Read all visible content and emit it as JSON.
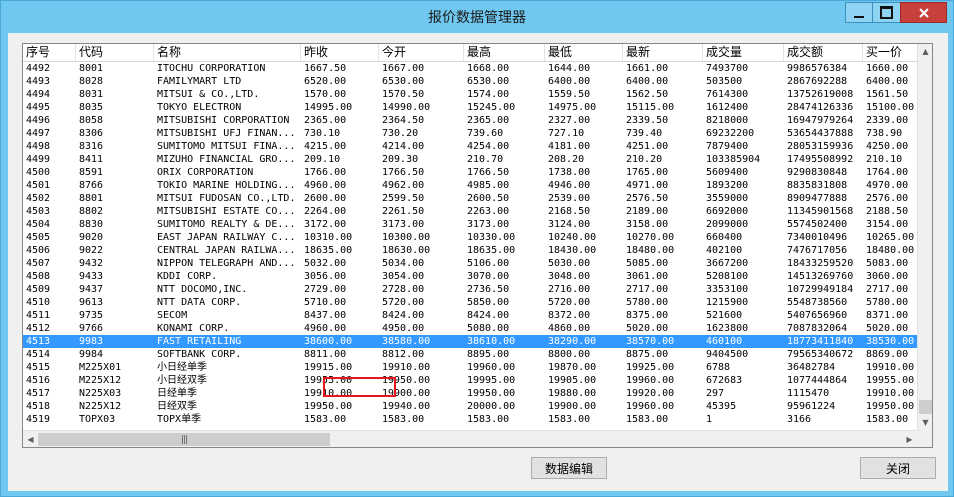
{
  "window": {
    "title": "报价数据管理器"
  },
  "table": {
    "columns": [
      {
        "label": "序号"
      },
      {
        "label": "代码"
      },
      {
        "label": "名称"
      },
      {
        "label": "昨收"
      },
      {
        "label": "今开"
      },
      {
        "label": "最高"
      },
      {
        "label": "最低"
      },
      {
        "label": "最新"
      },
      {
        "label": "成交量"
      },
      {
        "label": "成交额"
      },
      {
        "label": "买一价"
      }
    ],
    "rows": [
      [
        "4492",
        "8001",
        "ITOCHU CORPORATION",
        "1667.50",
        "1667.00",
        "1668.00",
        "1644.00",
        "1661.00",
        "7493700",
        "9986576384",
        "1660.00"
      ],
      [
        "4493",
        "8028",
        "FAMILYMART LTD",
        "6520.00",
        "6530.00",
        "6530.00",
        "6400.00",
        "6400.00",
        "503500",
        "2867692288",
        "6400.00"
      ],
      [
        "4494",
        "8031",
        "MITSUI & CO.,LTD.",
        "1570.00",
        "1570.50",
        "1574.00",
        "1559.50",
        "1562.50",
        "7614300",
        "13752619008",
        "1561.50"
      ],
      [
        "4495",
        "8035",
        "TOKYO ELECTRON",
        "14995.00",
        "14990.00",
        "15245.00",
        "14975.00",
        "15115.00",
        "1612400",
        "28474126336",
        "15100.00"
      ],
      [
        "4496",
        "8058",
        "MITSUBISHI CORPORATION",
        "2365.00",
        "2364.50",
        "2365.00",
        "2327.00",
        "2339.50",
        "8218000",
        "16947979264",
        "2339.00"
      ],
      [
        "4497",
        "8306",
        "MITSUBISHI UFJ FINAN...",
        "730.10",
        "730.20",
        "739.60",
        "727.10",
        "739.40",
        "69232200",
        "53654437888",
        "738.90"
      ],
      [
        "4498",
        "8316",
        "SUMITOMO MITSUI FINA...",
        "4215.00",
        "4214.00",
        "4254.00",
        "4181.00",
        "4251.00",
        "7879400",
        "28053159936",
        "4250.00"
      ],
      [
        "4499",
        "8411",
        "MIZUHO FINANCIAL GRO...",
        "209.10",
        "209.30",
        "210.70",
        "208.20",
        "210.20",
        "103385904",
        "17495508992",
        "210.10"
      ],
      [
        "4500",
        "8591",
        "ORIX CORPORATION",
        "1766.00",
        "1766.50",
        "1766.50",
        "1738.00",
        "1765.00",
        "5609400",
        "9290830848",
        "1764.00"
      ],
      [
        "4501",
        "8766",
        "TOKIO MARINE HOLDING...",
        "4960.00",
        "4962.00",
        "4985.00",
        "4946.00",
        "4971.00",
        "1893200",
        "8835831808",
        "4970.00"
      ],
      [
        "4502",
        "8801",
        "MITSUI FUDOSAN CO.,LTD.",
        "2600.00",
        "2599.50",
        "2600.50",
        "2539.00",
        "2576.50",
        "3559000",
        "8909477888",
        "2576.00"
      ],
      [
        "4503",
        "8802",
        "MITSUBISHI ESTATE CO...",
        "2264.00",
        "2261.50",
        "2263.00",
        "2168.50",
        "2189.00",
        "6692000",
        "11345901568",
        "2188.50"
      ],
      [
        "4504",
        "8830",
        "SUMITOMO REALTY & DE...",
        "3172.00",
        "3173.00",
        "3173.00",
        "3124.00",
        "3158.00",
        "2099000",
        "5574502400",
        "3154.00"
      ],
      [
        "4505",
        "9020",
        "EAST JAPAN RAILWAY C...",
        "10310.00",
        "10300.00",
        "10330.00",
        "10240.00",
        "10270.00",
        "660400",
        "7340010496",
        "10265.00"
      ],
      [
        "4506",
        "9022",
        "CENTRAL JAPAN RAILWA...",
        "18635.00",
        "18630.00",
        "18635.00",
        "18430.00",
        "18480.00",
        "402100",
        "7476717056",
        "18480.00"
      ],
      [
        "4507",
        "9432",
        "NIPPON TELEGRAPH AND...",
        "5032.00",
        "5034.00",
        "5106.00",
        "5030.00",
        "5085.00",
        "3667200",
        "18433259520",
        "5083.00"
      ],
      [
        "4508",
        "9433",
        "KDDI CORP.",
        "3056.00",
        "3054.00",
        "3070.00",
        "3048.00",
        "3061.00",
        "5208100",
        "14513269760",
        "3060.00"
      ],
      [
        "4509",
        "9437",
        "NTT DOCOMO,INC.",
        "2729.00",
        "2728.00",
        "2736.50",
        "2716.00",
        "2717.00",
        "3353100",
        "10729949184",
        "2717.00"
      ],
      [
        "4510",
        "9613",
        "NTT DATA CORP.",
        "5710.00",
        "5720.00",
        "5850.00",
        "5720.00",
        "5780.00",
        "1215900",
        "5548738560",
        "5780.00"
      ],
      [
        "4511",
        "9735",
        "SECOM",
        "8437.00",
        "8424.00",
        "8424.00",
        "8372.00",
        "8375.00",
        "521600",
        "5407656960",
        "8371.00"
      ],
      [
        "4512",
        "9766",
        "KONAMI CORP.",
        "4960.00",
        "4950.00",
        "5080.00",
        "4860.00",
        "5020.00",
        "1623800",
        "7087832064",
        "5020.00"
      ],
      [
        "4513",
        "9983",
        "FAST RETAILING",
        "38600.00",
        "38580.00",
        "38610.00",
        "38290.00",
        "38570.00",
        "460100",
        "18773411840",
        "38530.00"
      ],
      [
        "4514",
        "9984",
        "SOFTBANK CORP.",
        "8811.00",
        "8812.00",
        "8895.00",
        "8800.00",
        "8875.00",
        "9404500",
        "79565340672",
        "8869.00"
      ],
      [
        "4515",
        "M225X01",
        "小日经单季",
        "19915.00",
        "19910.00",
        "19960.00",
        "19870.00",
        "19925.00",
        "6788",
        "36482784",
        "19910.00"
      ],
      [
        "4516",
        "M225X12",
        "小日经双季",
        "19955.00",
        "19950.00",
        "19995.00",
        "19905.00",
        "19960.00",
        "672683",
        "1077444864",
        "19955.00"
      ],
      [
        "4517",
        "N225X03",
        "日经单季",
        "19910.00",
        "19900.00",
        "19950.00",
        "19880.00",
        "19920.00",
        "297",
        "1115470",
        "19910.00"
      ],
      [
        "4518",
        "N225X12",
        "日经双季",
        "19950.00",
        "19940.00",
        "20000.00",
        "19900.00",
        "19960.00",
        "45395",
        "95961224",
        "19950.00"
      ],
      [
        "4519",
        "TOPX03",
        "TOPX单季",
        "1583.00",
        "1583.00",
        "1583.00",
        "1583.00",
        "1583.00",
        "1",
        "3166",
        "1583.00"
      ]
    ],
    "selected_row_index": 21
  },
  "buttons": {
    "edit": "数据编辑",
    "close": "关闭"
  },
  "icons": {
    "minimize": "minimize-icon",
    "maximize": "maximize-icon",
    "close": "close-icon"
  }
}
